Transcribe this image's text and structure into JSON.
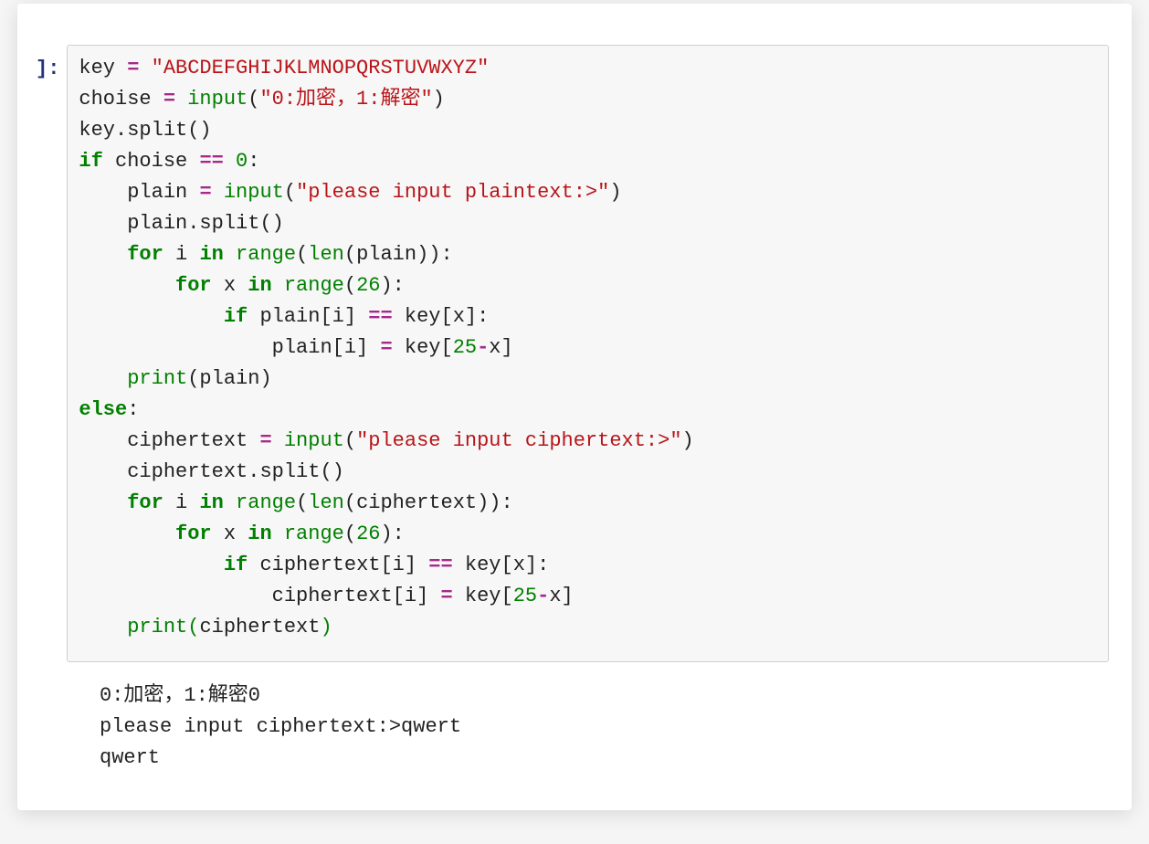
{
  "prompt": "]:",
  "code": {
    "l1": {
      "kw_if": "",
      "v": "key",
      "op": "=",
      "s": "\"ABCDEFGHIJKLMNOPQRSTUVWXYZ\""
    },
    "l2": {
      "v": "choise",
      "op": "=",
      "bi": "input",
      "s": "\"0:加密，1:解密\""
    },
    "l3": {
      "t": "key.split()"
    },
    "l4": {
      "kw": "if",
      "t": " choise ",
      "op": "==",
      "n": "0",
      "c": ":"
    },
    "l5": {
      "t": "plain ",
      "op": "=",
      "bi": " input",
      "s": "\"please input plaintext:>\""
    },
    "l6": {
      "t": "plain.split()"
    },
    "l7": {
      "kw": "for",
      "t1": " i ",
      "kw2": "in",
      "bi": " range",
      "p1": "(",
      "bi2": "len",
      "p2": "(plain)):"
    },
    "l8": {
      "kw": "for",
      "t1": " x ",
      "kw2": "in",
      "bi": " range",
      "p": "(",
      "n": "26",
      "p2": "):"
    },
    "l9": {
      "kw": "if",
      "t": " plain[i] ",
      "op": "==",
      "t2": " key[x]:"
    },
    "l10": {
      "t": "plain[i] ",
      "op": "=",
      "t2": " key[",
      "n": "25",
      "op2": "-",
      "t3": "x]"
    },
    "l11": {
      "bi": "print",
      "t": "(plain)"
    },
    "l12": {
      "kw": "else",
      "c": ":"
    },
    "l13": {
      "t": "ciphertext ",
      "op": "=",
      "bi": " input",
      "s": "\"please input ciphertext:>\""
    },
    "l14": {
      "t": "ciphertext.split()"
    },
    "l15": {
      "kw": "for",
      "t1": " i ",
      "kw2": "in",
      "bi": " range",
      "p1": "(",
      "bi2": "len",
      "p2": "(ciphertext)):"
    },
    "l16": {
      "kw": "for",
      "t1": " x ",
      "kw2": "in",
      "bi": " range",
      "p": "(",
      "n": "26",
      "p2": "):"
    },
    "l17": {
      "kw": "if",
      "t": " ciphertext[i] ",
      "op": "==",
      "t2": " key[x]:"
    },
    "l18": {
      "t": "ciphertext[i] ",
      "op": "=",
      "t2": " key[",
      "n": "25",
      "op2": "-",
      "t3": "x]"
    },
    "l19": {
      "bi": "print",
      "p1": "(",
      "t": "ciphertext",
      "p2": ")"
    }
  },
  "output": {
    "line1": "0:加密，1:解密0",
    "line2": "please input ciphertext:>qwert",
    "line3": "qwert"
  }
}
